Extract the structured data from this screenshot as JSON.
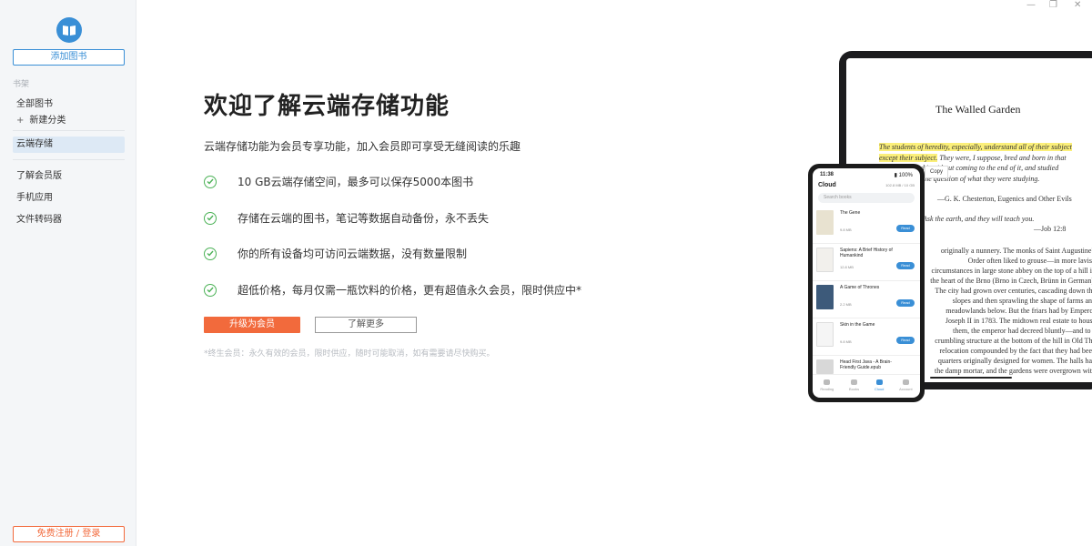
{
  "sidebar": {
    "add_book": "添加图书",
    "section": "书架",
    "all_books": "全部图书",
    "new_category": "新建分类",
    "cloud_storage": "云端存储",
    "membership": "了解会员版",
    "mobile_app": "手机应用",
    "converter": "文件转码器",
    "register": "免费注册 / 登录"
  },
  "window": {
    "minimize": "—",
    "restore": "❐",
    "close": "✕"
  },
  "main": {
    "title": "欢迎了解云端存储功能",
    "subtitle": "云端存储功能为会员专享功能，加入会员即可享受无缝阅读的乐趣",
    "features": [
      "10 GB云端存储空间，最多可以保存5000本图书",
      "存储在云端的图书，笔记等数据自动备份，永不丢失",
      "你的所有设备均可访问云端数据，没有数量限制",
      "超低价格，每月仅需一瓶饮料的价格，更有超值永久会员，限时供应中*"
    ],
    "upgrade": "升级为会员",
    "learn_more": "了解更多",
    "footnote": "*终生会员：永久有效的会员，限时供应，随时可能取消，如有需要请尽快购买。"
  },
  "tablet": {
    "book_title": "The Walled Garden",
    "quote_highlight": "The students of heredity, especially, understand all of their subject except their subject.",
    "quote_rest": " They were, I suppose, bred and born in that brake, explored it without coming to the end of it, and studied everything but the question of what they were studying.",
    "quote_attr": "—G. K. Chesterton, Eugenics and Other Evils",
    "verse": "Ask the earth, and they will teach you.",
    "verse_attr": "—Job 12:8",
    "copy": "Copy",
    "body": "originally a nunnery. The monks of Saint Augustine's Order often liked to grouse—in more lavish circumstances in large stone abbey on the top of a hill in the heart of the Brno (Brno in Czech, Brünn in German). The city had grown over centuries, cascading down the slopes and then sprawling the shape of farms and meadowlands below. But the friars had by Emperor Joseph II in 1783. The midtown real estate to house them, the emperor had decreed bluntly—and to a crumbling structure at the bottom of the hill in Old The relocation compounded by the fact that they had been quarters originally designed for women. The halls had the damp mortar, and the gardens were overgrown with"
  },
  "phone": {
    "time": "11:38",
    "battery": "▮ 100%",
    "header": "Cloud",
    "storage": "102.8 MB / 10 GB",
    "search": "Search books",
    "read": "Read",
    "books": [
      {
        "title": "The Gene",
        "size": "9.8 MB",
        "color": "#e8e2d0"
      },
      {
        "title": "Sapiens: A Brief History of Humankind",
        "size": "12.8 MB",
        "color": "#f2f0ec"
      },
      {
        "title": "A Game of Thrones",
        "size": "2.2 MB",
        "color": "#3d5a7a"
      },
      {
        "title": "Skin in the Game",
        "size": "9.8 MB",
        "color": "#f5f5f5"
      },
      {
        "title": "Head First Java - A Brain-Friendly Guide.epub",
        "size": "",
        "color": "#d8d8d8"
      }
    ],
    "tabs": [
      "Reading",
      "Books",
      "Cloud",
      "Account"
    ]
  },
  "colors": {
    "accent": "#3a8fd6",
    "cta": "#f26a3c",
    "check": "#4cb257"
  }
}
